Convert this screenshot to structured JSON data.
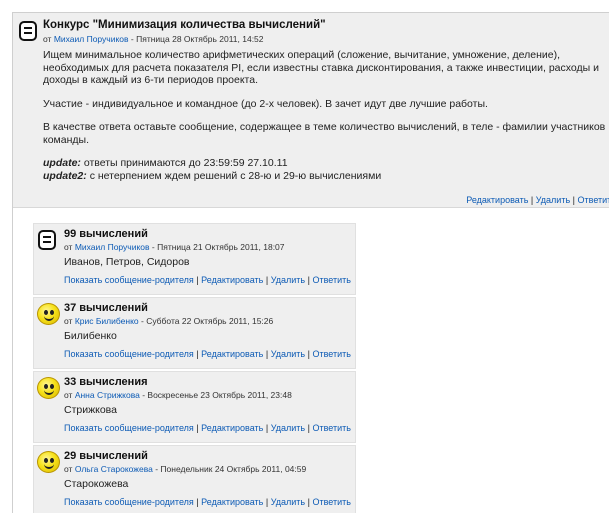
{
  "main_post": {
    "title": "Конкурс \"Минимизация количества вычислений\"",
    "byline_prefix": "от",
    "author": "Михаил Поручиков",
    "byline_date": "- Пятница 28 Октябрь 2011, 14:52",
    "body": [
      "Ищем минимальное количество арифметических операций (сложение, вычитание, умножение, деление), необходимых для расчета показателя PI, если известны ставка дисконтирования, а также инвестиции, расходы и доходы в каждый из 6-ти периодов проекта.",
      "Участие - индивидуальное и командное (до 2-х человек). В зачет идут две лучшие работы.",
      "В качестве ответа оставьте сообщение, содержащее в теме количество вычислений, в теле - фамилии участников команды."
    ],
    "update_label": "update:",
    "update_text": "ответы принимаются до 23:59:59 27.10.11",
    "update2_label": "update2:",
    "update2_text": "с нетерпением ждем решений с 28-ю и 29-ю вычислениями",
    "links": {
      "edit": "Редактировать",
      "delete": "Удалить",
      "reply": "Ответить"
    }
  },
  "replies": [
    {
      "title": "99 вычислений",
      "author": "Михаил Поручиков",
      "date": "- Пятница 21 Октябрь 2011, 18:07",
      "body": "Иванов, Петров, Сидоров",
      "avatar": "picture-icon"
    },
    {
      "title": "37 вычислений",
      "author": "Крис Билибенко",
      "date": "- Суббота 22 Октябрь 2011, 15:26",
      "body": "Билибенко",
      "avatar": "smiley-icon"
    },
    {
      "title": "33 вычисления",
      "author": "Анна Стрижкова",
      "date": "- Воскресенье 23 Октябрь 2011, 23:48",
      "body": "Стрижкова",
      "avatar": "smiley-icon"
    },
    {
      "title": "29 вычислений",
      "author": "Ольга Старокожева",
      "date": "- Понедельник 24 Октябрь 2011, 04:59",
      "body": "Старокожева",
      "avatar": "smiley-icon"
    }
  ],
  "reply_byline_prefix": "от",
  "reply_links": {
    "parent": "Показать сообщение-родителя",
    "edit": "Редактировать",
    "delete": "Удалить",
    "reply": "Ответить"
  },
  "separator": "|"
}
